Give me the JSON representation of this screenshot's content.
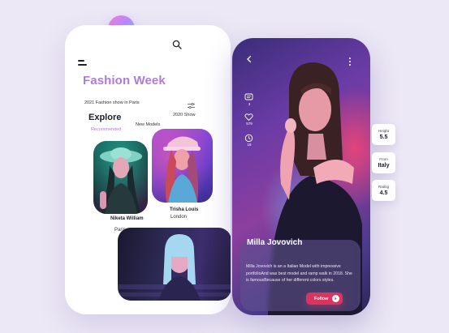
{
  "left_phone": {
    "title": "Fashion Week",
    "subtitle": "2021 Fashion show in Paris",
    "section_title": "Explore",
    "tabs": [
      {
        "label": "Recommended",
        "active": true
      },
      {
        "label": "New Models",
        "active": false
      },
      {
        "label": "2020 Show",
        "active": false
      }
    ],
    "models": [
      {
        "name": "Niketa William",
        "location": "Paris"
      },
      {
        "name": "Trisha Louis",
        "location": "London"
      }
    ],
    "icons": [
      "menu-icon",
      "search-icon",
      "filter-icon"
    ]
  },
  "right_phone": {
    "name": "Milla Jovovich",
    "description": "Milla Jovovich is an a Italian Model with impressive portfolioAnd was best model and ramp walk in 2018. She is famousBecause of her different colors styles.",
    "follow_label": "Follow",
    "side_stats": [
      {
        "icon": "comment-icon",
        "value": "3"
      },
      {
        "icon": "heart-icon",
        "value": "579"
      },
      {
        "icon": "clock-icon",
        "value": "18"
      }
    ]
  },
  "stats": [
    {
      "label": "Height",
      "value": "5.5"
    },
    {
      "label": "From",
      "value": "Italy"
    },
    {
      "label": "Rating",
      "value": "4.5"
    }
  ],
  "colors": {
    "background": "#ece8f5",
    "accent_purple": "#b07ae0",
    "follow_button": "#d83560"
  }
}
